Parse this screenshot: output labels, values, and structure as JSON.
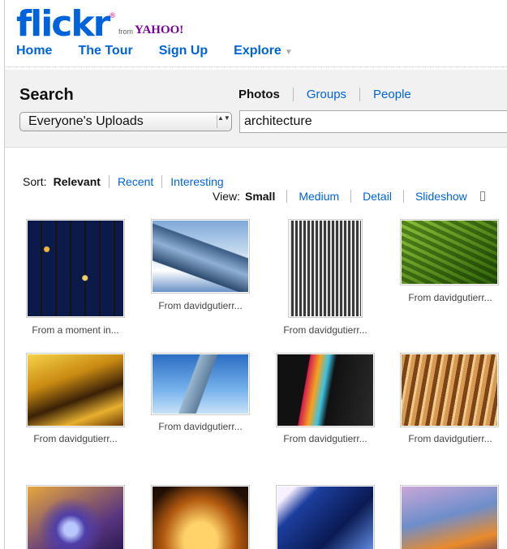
{
  "header": {
    "logo_main": "flickr",
    "logo_r": "r",
    "logo_reg": "®",
    "logo_from": "from",
    "logo_yahoo": "YAHOO!"
  },
  "nav": {
    "items": [
      {
        "label": "Home"
      },
      {
        "label": "The Tour"
      },
      {
        "label": "Sign Up"
      },
      {
        "label": "Explore"
      }
    ],
    "explore_caret": "▼"
  },
  "search": {
    "title": "Search",
    "scope_value": "Everyone's Uploads",
    "scope_arrows": "▲▼",
    "tabs": [
      {
        "label": "Photos"
      },
      {
        "label": "Groups"
      },
      {
        "label": "People"
      }
    ],
    "query": "architecture"
  },
  "sort": {
    "label": "Sort:",
    "options": [
      {
        "label": "Relevant"
      },
      {
        "label": "Recent"
      },
      {
        "label": "Interesting"
      }
    ]
  },
  "view": {
    "label": "View:",
    "options": [
      {
        "label": "Small"
      },
      {
        "label": "Medium"
      },
      {
        "label": "Detail"
      },
      {
        "label": "Slideshow"
      }
    ]
  },
  "results": [
    {
      "caption": "From a moment in..."
    },
    {
      "caption": "From davidgutierr..."
    },
    {
      "caption": "From davidgutierr..."
    },
    {
      "caption": "From davidgutierr..."
    },
    {
      "caption": "From davidgutierr..."
    },
    {
      "caption": "From davidgutierr..."
    },
    {
      "caption": "From davidgutierr..."
    },
    {
      "caption": "From davidgutierr..."
    },
    {
      "caption": ""
    },
    {
      "caption": ""
    },
    {
      "caption": ""
    },
    {
      "caption": ""
    }
  ],
  "colors": {
    "flickr_blue": "#0063dc",
    "flickr_pink": "#ff0084",
    "yahoo_purple": "#7b0099"
  }
}
